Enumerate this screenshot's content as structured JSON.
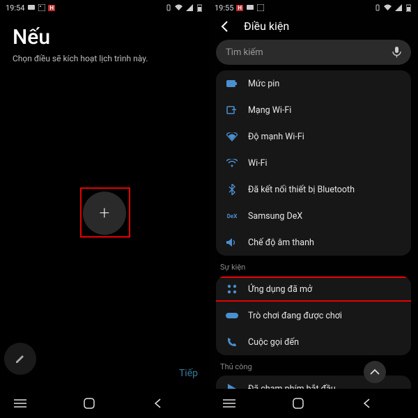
{
  "left": {
    "status": {
      "time": "19:54"
    },
    "title": "Nếu",
    "subtitle": "Chọn điều sẽ kích hoạt lịch trình này.",
    "add_label": "+",
    "next_label": "Tiếp"
  },
  "right": {
    "status": {
      "time": "19:55"
    },
    "header": "Điều kiện",
    "search_placeholder": "Tìm kiếm",
    "group1": [
      {
        "icon": "battery-icon",
        "label": "Mức pin"
      },
      {
        "icon": "wifi-network-icon",
        "label": "Mạng Wi-Fi"
      },
      {
        "icon": "wifi-strength-icon",
        "label": "Độ mạnh Wi-Fi"
      },
      {
        "icon": "wifi-icon",
        "label": "Wi-Fi"
      },
      {
        "icon": "bluetooth-icon",
        "label": "Đã kết nối thiết bị Bluetooth"
      },
      {
        "icon": "dex-icon",
        "label": "Samsung DeX"
      },
      {
        "icon": "sound-icon",
        "label": "Chế độ âm thanh"
      }
    ],
    "section_event": "Sự kiện",
    "group2": [
      {
        "icon": "apps-icon",
        "label": "Ứng dụng đã mở",
        "highlight": true
      },
      {
        "icon": "gamepad-icon",
        "label": "Trò chơi đang được chơi"
      },
      {
        "icon": "phone-icon",
        "label": "Cuộc gọi đến"
      }
    ],
    "section_manual": "Thủ công",
    "group3": [
      {
        "icon": "play-icon",
        "label": "Đã chạm phím bắt đầu"
      }
    ]
  }
}
